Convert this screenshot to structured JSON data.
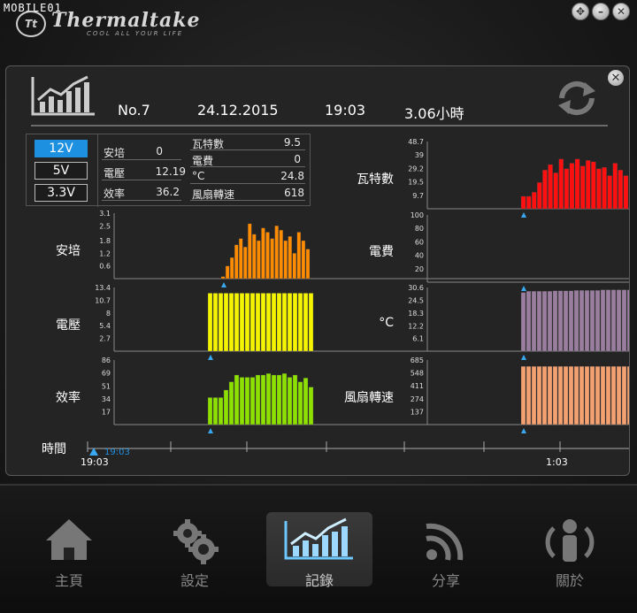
{
  "watermark": "MOBILE01",
  "brand": {
    "name": "Thermaltake",
    "tagline": "COOL ALL YOUR LIFE",
    "badge": "Tt"
  },
  "record": {
    "no": "No.7",
    "date": "24.12.2015",
    "time": "19:03",
    "duration": "3.06小時"
  },
  "voltages": [
    "12V",
    "5V",
    "3.3V"
  ],
  "active_voltage": "12V",
  "stats": [
    {
      "label": "安培",
      "value": "0"
    },
    {
      "label": "電壓",
      "value": "12.19"
    },
    {
      "label": "效率",
      "value": "36.2"
    },
    {
      "label": "瓦特數",
      "value": "9.5"
    },
    {
      "label": "電費",
      "value": "0"
    },
    {
      "label": "°C",
      "value": "24.8"
    },
    {
      "label": "風扇轉速",
      "value": "618"
    }
  ],
  "chart_data": [
    {
      "type": "bar",
      "title": "安培",
      "yticks": [
        "3.1",
        "2.5",
        "1.8",
        "1.2",
        "0.6"
      ],
      "ylim": [
        0,
        3.1
      ],
      "color": "#ff8c00",
      "values": [
        0.1,
        0.6,
        1.0,
        1.6,
        1.9,
        1.5,
        2.6,
        2.1,
        1.8,
        2.4,
        2.2,
        1.9,
        2.5,
        2.3,
        1.8,
        2.0,
        1.2,
        2.2,
        1.8,
        1.4
      ]
    },
    {
      "type": "bar",
      "title": "電壓",
      "yticks": [
        "13.4",
        "10.7",
        "8",
        "5.4",
        "2.7"
      ],
      "ylim": [
        0,
        13.4
      ],
      "color": "#f4f400",
      "values": [
        12.2,
        12.2,
        12.2,
        12.2,
        12.2,
        12.2,
        12.2,
        12.2,
        12.2,
        12.2,
        12.2,
        12.2,
        12.2,
        12.2,
        12.2,
        12.2,
        12.2,
        12.2,
        12.2,
        12.2
      ]
    },
    {
      "type": "bar",
      "title": "效率",
      "yticks": [
        "86",
        "69",
        "51",
        "34",
        "17"
      ],
      "ylim": [
        0,
        86
      ],
      "color": "#8ee000",
      "values": [
        36,
        36,
        36,
        46,
        57,
        66,
        63,
        63,
        63,
        66,
        66,
        68,
        66,
        66,
        68,
        63,
        66,
        57,
        62,
        50
      ]
    },
    {
      "type": "bar",
      "title": "瓦特數",
      "yticks": [
        "48.7",
        "39",
        "29.2",
        "19.5",
        "9.7"
      ],
      "ylim": [
        0,
        48.7
      ],
      "color": "#ff1010",
      "values": [
        9,
        9,
        12,
        19,
        28,
        32,
        26,
        36,
        29,
        33,
        36,
        31,
        35,
        34,
        29,
        30,
        24,
        33,
        28,
        24
      ]
    },
    {
      "type": "bar",
      "title": "電費",
      "yticks": [
        "100",
        "80",
        "60",
        "40",
        "20"
      ],
      "ylim": [
        0,
        100
      ],
      "color": "#ff1010",
      "values": []
    },
    {
      "type": "bar",
      "title": "°C",
      "yticks": [
        "30.6",
        "24.5",
        "18.3",
        "12.2",
        "6.1"
      ],
      "ylim": [
        0,
        30.6
      ],
      "color": "#9a7ea0",
      "values": [
        28.2,
        28.8,
        28.8,
        28.8,
        28.8,
        28.8,
        29.0,
        29.0,
        29.0,
        29.0,
        29.2,
        29.2,
        29.2,
        29.2,
        29.2,
        29.5,
        29.5,
        29.5,
        29.5,
        29.5,
        29.5,
        29.5
      ]
    },
    {
      "type": "bar",
      "title": "風扇轉速",
      "yticks": [
        "685",
        "548",
        "411",
        "274",
        "137"
      ],
      "ylim": [
        0,
        685
      ],
      "color": "#f4a070",
      "values": [
        618,
        618,
        618,
        618,
        618,
        618,
        618,
        618,
        618,
        618,
        618,
        618,
        618,
        618,
        618,
        618,
        618,
        618,
        618,
        618,
        618,
        618
      ]
    }
  ],
  "timeline": {
    "label": "時間",
    "start": "19:03",
    "end": "1:03",
    "marker": "19:03"
  },
  "nav": [
    {
      "label": "主頁",
      "icon": "home-icon"
    },
    {
      "label": "設定",
      "icon": "settings-gears-icon"
    },
    {
      "label": "記錄",
      "icon": "chart-record-icon"
    },
    {
      "label": "分享",
      "icon": "share-rss-icon"
    },
    {
      "label": "關於",
      "icon": "about-person-icon"
    }
  ],
  "nav_active": "記錄"
}
